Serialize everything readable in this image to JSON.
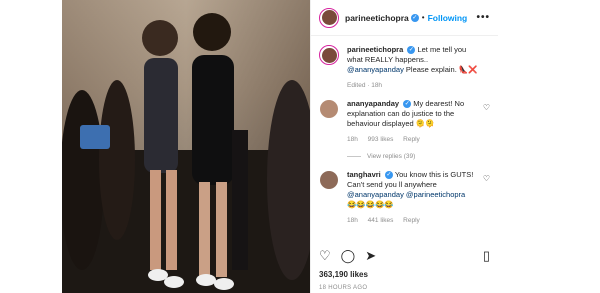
{
  "post": {
    "username": "parineetichopra",
    "follow_label": "Following",
    "more_label": "•••",
    "caption": {
      "username": "parineetichopra",
      "text_before": "Let me tell you what REALLY happens..",
      "mention": "@ananyapanday",
      "text_after": "Please explain. 👠❌",
      "meta": "Edited · 18h"
    },
    "comments": [
      {
        "username": "ananyapanday",
        "text": "My dearest! No explanation can do justice to the behaviour displayed 🫠🫠",
        "time": "18h",
        "likes": "993 likes",
        "reply": "Reply",
        "view_replies": "View replies (39)"
      },
      {
        "username": "tanghavri",
        "text": "You know this is GUTS! Can't send you ll anywhere",
        "mentions": "@ananyapanday @parineetichopra",
        "emojis": "😂😂😂😂😂",
        "time": "18h",
        "likes": "441 likes",
        "reply": "Reply"
      }
    ],
    "likes_count": "363,190 likes",
    "time_ago": "18 HOURS AGO"
  },
  "icons": [
    "heart-icon",
    "comment-icon",
    "share-icon",
    "bookmark-icon",
    "verified-icon",
    "more-icon"
  ]
}
